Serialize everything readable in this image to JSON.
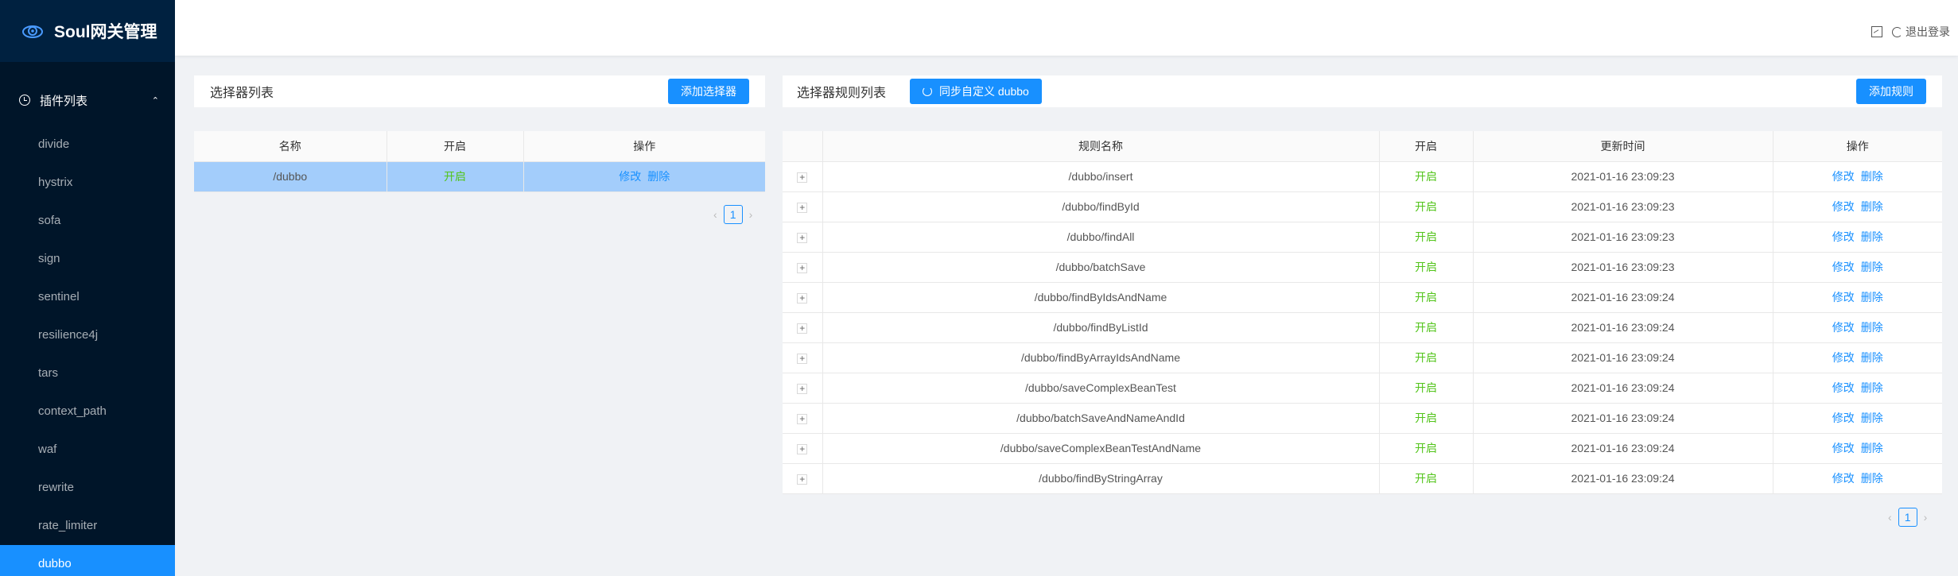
{
  "app": {
    "title": "Soul网关管理"
  },
  "sidebar": {
    "section_label": "插件列表",
    "items": [
      "divide",
      "hystrix",
      "sofa",
      "sign",
      "sentinel",
      "resilience4j",
      "tars",
      "context_path",
      "waf",
      "rewrite",
      "rate_limiter",
      "dubbo"
    ],
    "active_item": "dubbo"
  },
  "header": {
    "logout_label": "退出登录"
  },
  "selector_panel": {
    "title": "选择器列表",
    "add_button": "添加选择器",
    "columns": [
      "名称",
      "开启",
      "操作"
    ],
    "rows": [
      {
        "name": "/dubbo",
        "status": "开启",
        "edit": "修改",
        "delete": "删除"
      }
    ],
    "page": "1"
  },
  "rule_panel": {
    "title": "选择器规则列表",
    "sync_button": "同步自定义 dubbo",
    "add_button": "添加规则",
    "columns": [
      "规则名称",
      "开启",
      "更新时间",
      "操作"
    ],
    "rows": [
      {
        "name": "/dubbo/insert",
        "status": "开启",
        "time": "2021-01-16 23:09:23",
        "edit": "修改",
        "delete": "删除"
      },
      {
        "name": "/dubbo/findById",
        "status": "开启",
        "time": "2021-01-16 23:09:23",
        "edit": "修改",
        "delete": "删除"
      },
      {
        "name": "/dubbo/findAll",
        "status": "开启",
        "time": "2021-01-16 23:09:23",
        "edit": "修改",
        "delete": "删除"
      },
      {
        "name": "/dubbo/batchSave",
        "status": "开启",
        "time": "2021-01-16 23:09:23",
        "edit": "修改",
        "delete": "删除"
      },
      {
        "name": "/dubbo/findByIdsAndName",
        "status": "开启",
        "time": "2021-01-16 23:09:24",
        "edit": "修改",
        "delete": "删除"
      },
      {
        "name": "/dubbo/findByListId",
        "status": "开启",
        "time": "2021-01-16 23:09:24",
        "edit": "修改",
        "delete": "删除"
      },
      {
        "name": "/dubbo/findByArrayIdsAndName",
        "status": "开启",
        "time": "2021-01-16 23:09:24",
        "edit": "修改",
        "delete": "删除"
      },
      {
        "name": "/dubbo/saveComplexBeanTest",
        "status": "开启",
        "time": "2021-01-16 23:09:24",
        "edit": "修改",
        "delete": "删除"
      },
      {
        "name": "/dubbo/batchSaveAndNameAndId",
        "status": "开启",
        "time": "2021-01-16 23:09:24",
        "edit": "修改",
        "delete": "删除"
      },
      {
        "name": "/dubbo/saveComplexBeanTestAndName",
        "status": "开启",
        "time": "2021-01-16 23:09:24",
        "edit": "修改",
        "delete": "删除"
      },
      {
        "name": "/dubbo/findByStringArray",
        "status": "开启",
        "time": "2021-01-16 23:09:24",
        "edit": "修改",
        "delete": "删除"
      }
    ],
    "page": "1"
  },
  "icons": {
    "logo": "soul-logo-icon",
    "section": "clock-icon",
    "header_image": "image-icon",
    "logout": "logout-icon",
    "sync": "sync-icon"
  },
  "colors": {
    "sidebar_bg": "#001529",
    "accent": "#1890ff",
    "enabled": "#52c41a",
    "selected_row": "#a3cdfb"
  }
}
